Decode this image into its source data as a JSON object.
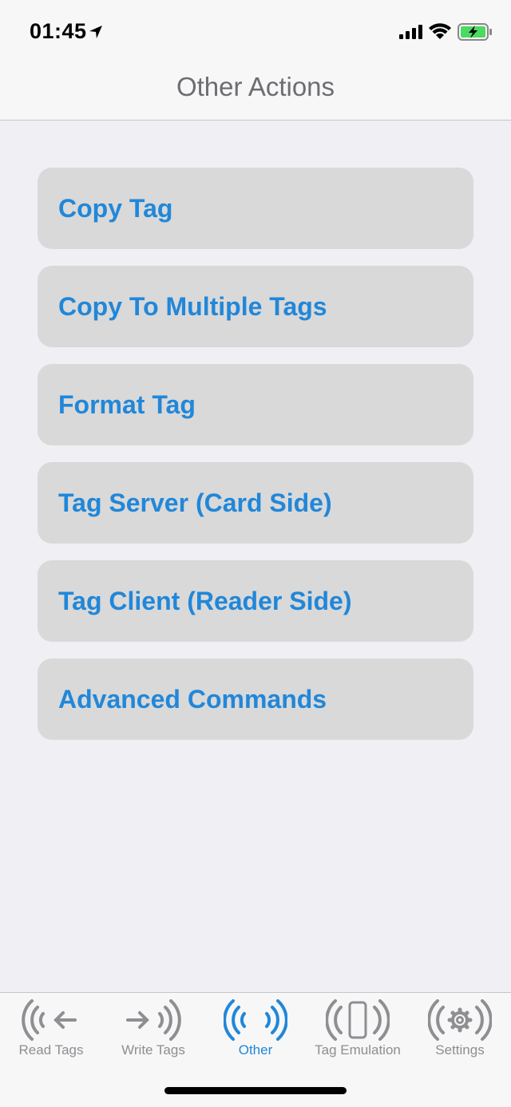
{
  "status_bar": {
    "time": "01:45",
    "icons": [
      "location-arrow-icon",
      "cellular-signal-icon",
      "wifi-icon",
      "battery-charging-icon"
    ]
  },
  "nav": {
    "title": "Other Actions"
  },
  "actions": [
    {
      "label": "Copy Tag"
    },
    {
      "label": "Copy To Multiple Tags"
    },
    {
      "label": "Format Tag"
    },
    {
      "label": "Tag Server (Card Side)"
    },
    {
      "label": "Tag Client (Reader Side)"
    },
    {
      "label": "Advanced Commands"
    }
  ],
  "tabs": [
    {
      "label": "Read Tags",
      "icon": "read-tags-icon",
      "active": false
    },
    {
      "label": "Write Tags",
      "icon": "write-tags-icon",
      "active": false
    },
    {
      "label": "Other",
      "icon": "other-icon",
      "active": true
    },
    {
      "label": "Tag Emulation",
      "icon": "tag-emulation-icon",
      "active": false
    },
    {
      "label": "Settings",
      "icon": "settings-icon",
      "active": false
    }
  ],
  "colors": {
    "accent": "#2187d9",
    "inactive": "#8e8e93",
    "button_bg": "#d9d9d9",
    "page_bg": "#efeff4",
    "battery_fill": "#4cd964"
  }
}
